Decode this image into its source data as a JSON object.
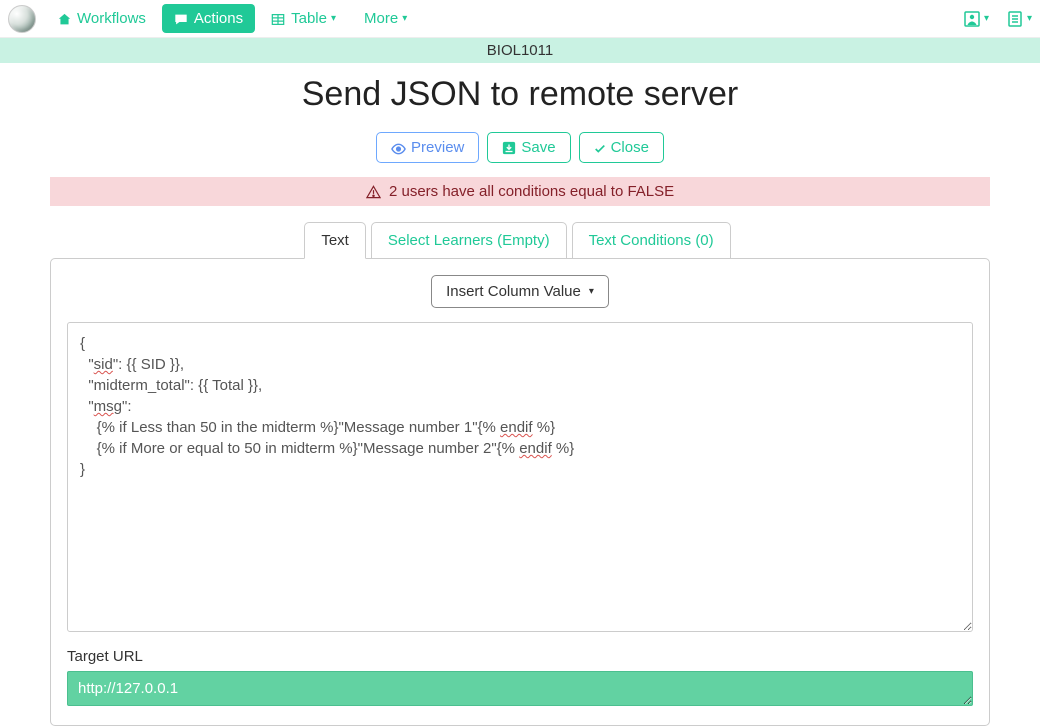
{
  "nav": {
    "workflows": "Workflows",
    "actions": "Actions",
    "table": "Table",
    "more": "More"
  },
  "project": "BIOL1011",
  "title": "Send JSON to remote server",
  "buttons": {
    "preview": "Preview",
    "save": "Save",
    "close": "Close"
  },
  "alert": "2 users have all conditions equal to FALSE",
  "tabs": {
    "text": "Text",
    "select": "Select Learners (Empty)",
    "conditions": "Text Conditions (0)"
  },
  "insert_btn": "Insert Column Value",
  "editor": {
    "l1": "{",
    "l2a": "  \"",
    "l2b": "sid",
    "l2c": "\": {{ SID }},",
    "l3": "  \"midterm_total\": {{ Total }},",
    "l4a": "  \"",
    "l4b": "msg",
    "l4c": "\":",
    "l5a": "    {% if Less than 50 in the midterm %}\"Message number 1\"{% ",
    "l5b": "endif",
    "l5c": " %}",
    "l6a": "    {% if More or equal to 50 in midterm %}\"Message number 2\"{% ",
    "l6b": "endif",
    "l6c": " %}",
    "l7": "}"
  },
  "url_label": "Target URL",
  "url_value": "http://127.0.0.1"
}
